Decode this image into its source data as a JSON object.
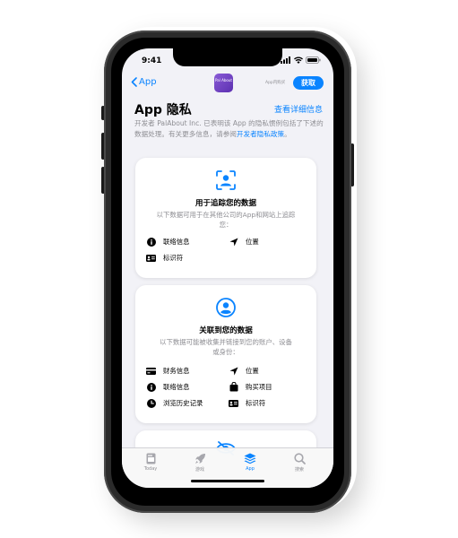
{
  "status": {
    "time": "9:41"
  },
  "nav": {
    "back_label": "App",
    "app_icon_text": "Pal About",
    "caption": "App内购买",
    "get_label": "获取"
  },
  "header": {
    "title": "App 隐私",
    "details_link": "查看详细信息"
  },
  "description": {
    "text": "开发者 PalAbout Inc. 已表明该 App 的隐私惯例包括了下述的数据处理。有关更多信息，请参阅",
    "link": "开发者隐私政策",
    "end": "。"
  },
  "cards": [
    {
      "title": "用于追踪您的数据",
      "subtitle": "以下数据可用于在其他公司的App和网站上追踪您：",
      "icon": "person-tracking-icon",
      "items": [
        {
          "icon": "info-icon",
          "label": "联络信息"
        },
        {
          "icon": "location-icon",
          "label": "位置"
        },
        {
          "icon": "id-card-icon",
          "label": "标识符"
        }
      ]
    },
    {
      "title": "关联到您的数据",
      "subtitle": "以下数据可能被收集并链接到您的账户、设备或身份：",
      "icon": "person-circle-icon",
      "items": [
        {
          "icon": "credit-card-icon",
          "label": "财务信息"
        },
        {
          "icon": "location-icon",
          "label": "位置"
        },
        {
          "icon": "info-icon",
          "label": "联络信息"
        },
        {
          "icon": "shopping-bag-icon",
          "label": "购买项目"
        },
        {
          "icon": "clock-icon",
          "label": "浏览历史记录"
        },
        {
          "icon": "id-card-icon",
          "label": "标识符"
        }
      ]
    }
  ],
  "tabs": [
    {
      "label": "Today",
      "icon": "today-icon"
    },
    {
      "label": "游戏",
      "icon": "rocket-icon"
    },
    {
      "label": "App",
      "icon": "layers-icon",
      "active": true
    },
    {
      "label": "搜索",
      "icon": "search-icon"
    }
  ],
  "colors": {
    "accent": "#0a84ff",
    "background": "#f2f2f7",
    "phone_frame": "#2b2b2b"
  }
}
